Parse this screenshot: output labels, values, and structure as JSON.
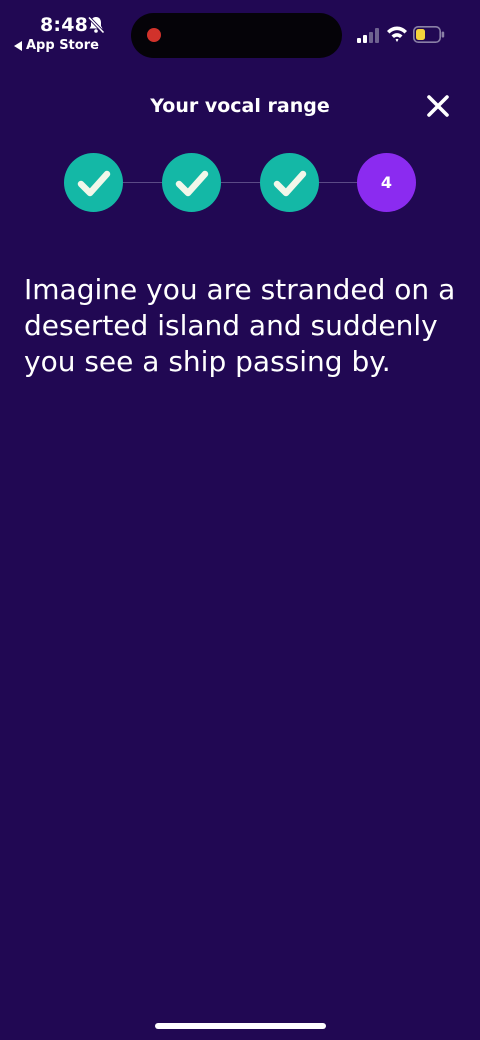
{
  "status_bar": {
    "time": "8:48",
    "back_app_label": "App Store",
    "battery_color": "#f5d33b"
  },
  "header": {
    "title": "Your vocal range"
  },
  "stepper": {
    "steps": [
      {
        "state": "done",
        "label": ""
      },
      {
        "state": "done",
        "label": ""
      },
      {
        "state": "done",
        "label": ""
      },
      {
        "state": "current",
        "label": "4"
      }
    ],
    "done_color": "#14b8a6",
    "current_color": "#8b2bf0"
  },
  "content": {
    "prompt": "Imagine you are stranded on a deserted island and suddenly you see a ship passing by."
  },
  "colors": {
    "background": "#210853"
  }
}
